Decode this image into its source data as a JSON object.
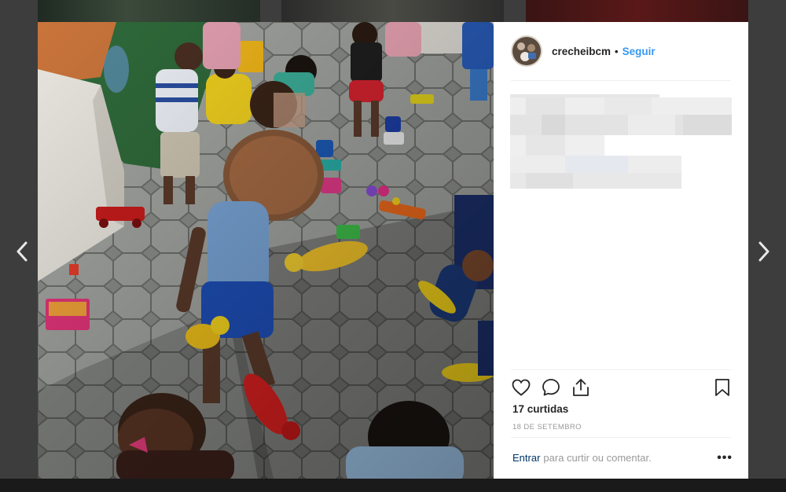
{
  "post": {
    "username": "crecheibcm",
    "separator": "•",
    "follow_label": "Seguir",
    "likes_text": "17 curtidas",
    "date_text": "18 DE SETEMBRO",
    "comment": {
      "login_label": "Entrar",
      "prompt": "para curtir ou comentar."
    },
    "more_label": "•••"
  },
  "icons": {
    "prev": "chevron-left-icon",
    "next": "chevron-right-icon",
    "like": "heart-icon",
    "comment": "comment-icon",
    "share": "share-icon",
    "save": "bookmark-icon"
  },
  "colors": {
    "follow": "#3897f0",
    "login_link": "#003569",
    "muted_text": "#999999",
    "primary_text": "#262626",
    "overlay": "#3d3d3d"
  }
}
